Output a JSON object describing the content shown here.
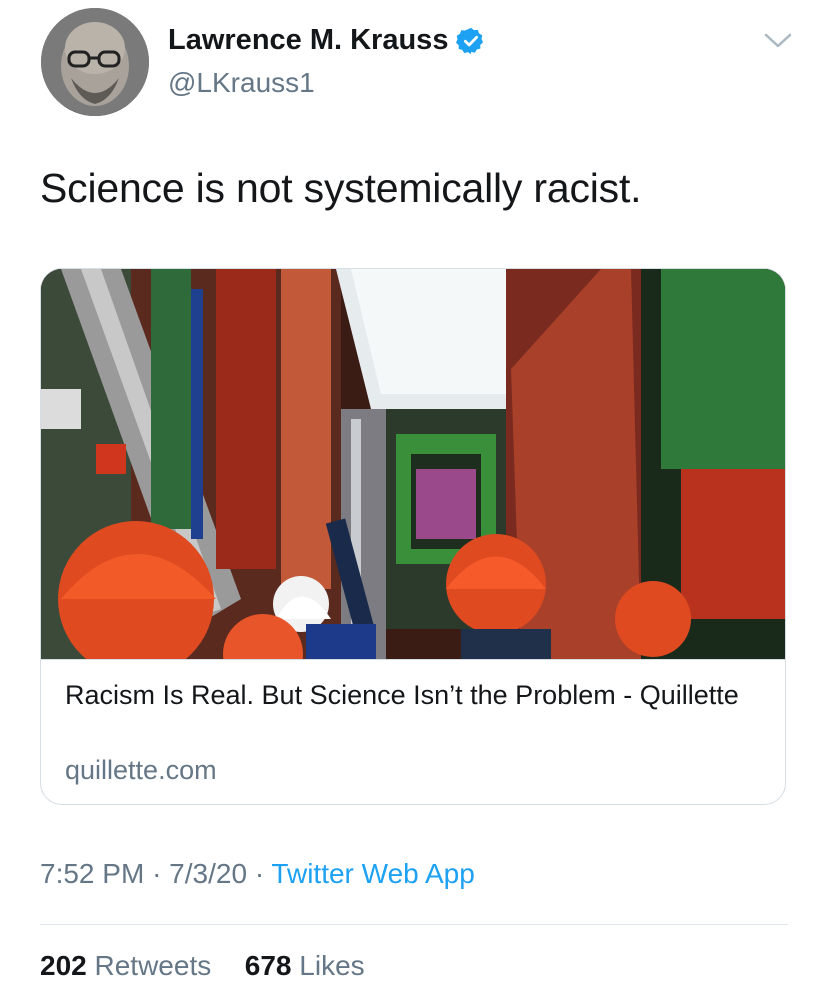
{
  "author": {
    "display_name": "Lawrence M. Krauss",
    "handle": "@LKrauss1",
    "verified": true,
    "avatar_icon": "profile-photo"
  },
  "tweet": {
    "text": "Science is not systemically racist."
  },
  "card": {
    "image_icon": "particle-detector-photo",
    "title": "Racism Is Real. But Science Isn’t the Problem - Quillette",
    "domain": "quillette.com"
  },
  "meta": {
    "time": "7:52 PM",
    "separator": "·",
    "date": "7/3/20",
    "source": "Twitter Web App"
  },
  "stats": {
    "retweets_count": "202",
    "retweets_label": "Retweets",
    "likes_count": "678",
    "likes_label": "Likes"
  },
  "colors": {
    "text": "#14171a",
    "secondary": "#657786",
    "accent": "#1da1f2",
    "border": "#d6dde3"
  },
  "icons": {
    "verified": "verified-badge-icon",
    "more": "chevron-down-icon"
  }
}
